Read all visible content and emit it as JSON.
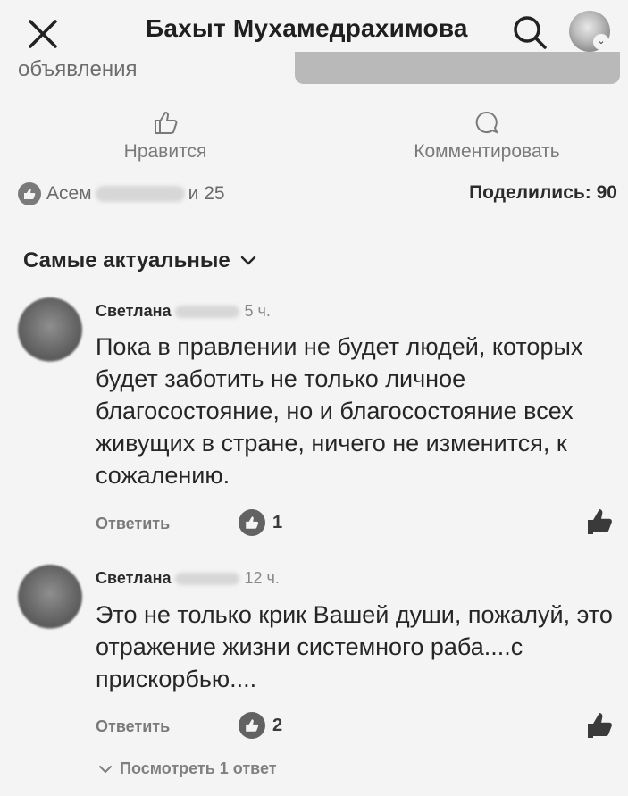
{
  "header": {
    "title": "Бахыт Мухамедрахимова"
  },
  "post": {
    "fragment_text": "объявления",
    "like_label": "Нравится",
    "comment_label": "Комментировать",
    "reactions_first_name": "Асем",
    "reactions_more": "и 25",
    "shares_label": "Поделились: 90"
  },
  "sort": {
    "label": "Самые актуальные"
  },
  "comments": [
    {
      "author": "Светлана",
      "time": "5 ч.",
      "text": "Пока в правлении не будет людей, которых будет заботить не только личное благосостояние, но и благосостояние всех живущих в стране, ничего не изменится, к сожалению.",
      "reply_label": "Ответить",
      "likes": "1"
    },
    {
      "author": "Светлана",
      "time": "12 ч.",
      "text": "Это не только крик Вашей души, пожалуй, это отражение жизни системного раба....с прискорбью....",
      "reply_label": "Ответить",
      "likes": "2",
      "view_replies_label": "Посмотреть 1 ответ"
    }
  ],
  "icons": {
    "close": "close-icon",
    "search": "search-icon",
    "thumbs_up": "thumbs-up-icon",
    "comment": "comment-icon",
    "chevron": "chevron-down-icon"
  }
}
